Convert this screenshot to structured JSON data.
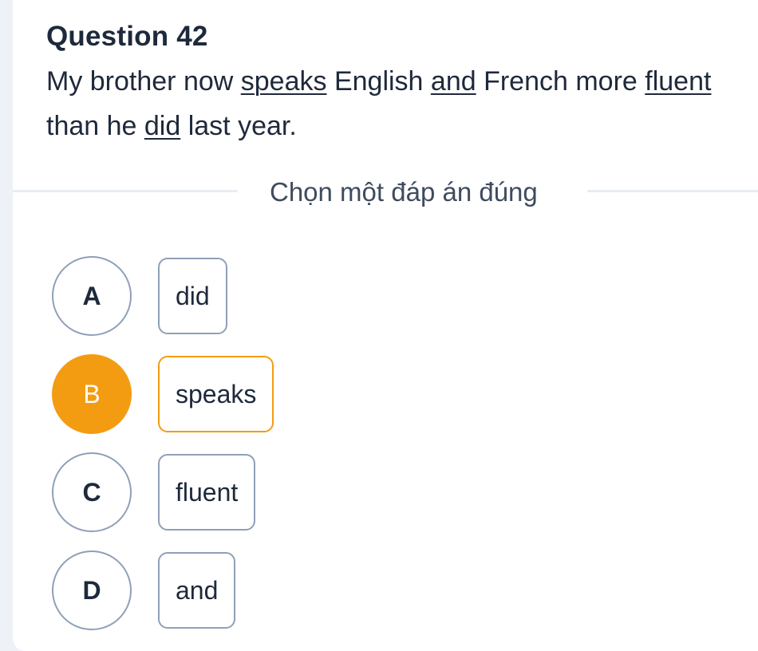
{
  "question": {
    "title": "Question 42",
    "segments": [
      {
        "text": "My brother now ",
        "underlined": false
      },
      {
        "text": "speaks",
        "underlined": true
      },
      {
        "text": " English ",
        "underlined": false
      },
      {
        "text": "and",
        "underlined": true
      },
      {
        "text": " French more ",
        "underlined": false
      },
      {
        "text": "fluent",
        "underlined": true
      },
      {
        "text": " than he ",
        "underlined": false
      },
      {
        "text": "did",
        "underlined": true
      },
      {
        "text": " last year.",
        "underlined": false
      }
    ]
  },
  "instruction": "Chọn một đáp án đúng",
  "options": [
    {
      "letter": "A",
      "text": "did",
      "selected": false
    },
    {
      "letter": "B",
      "text": "speaks",
      "selected": true
    },
    {
      "letter": "C",
      "text": "fluent",
      "selected": false
    },
    {
      "letter": "D",
      "text": "and",
      "selected": false
    }
  ],
  "colors": {
    "selected_accent": "#f39c12",
    "option_border": "#8fa0b8",
    "text": "#1e293b"
  }
}
